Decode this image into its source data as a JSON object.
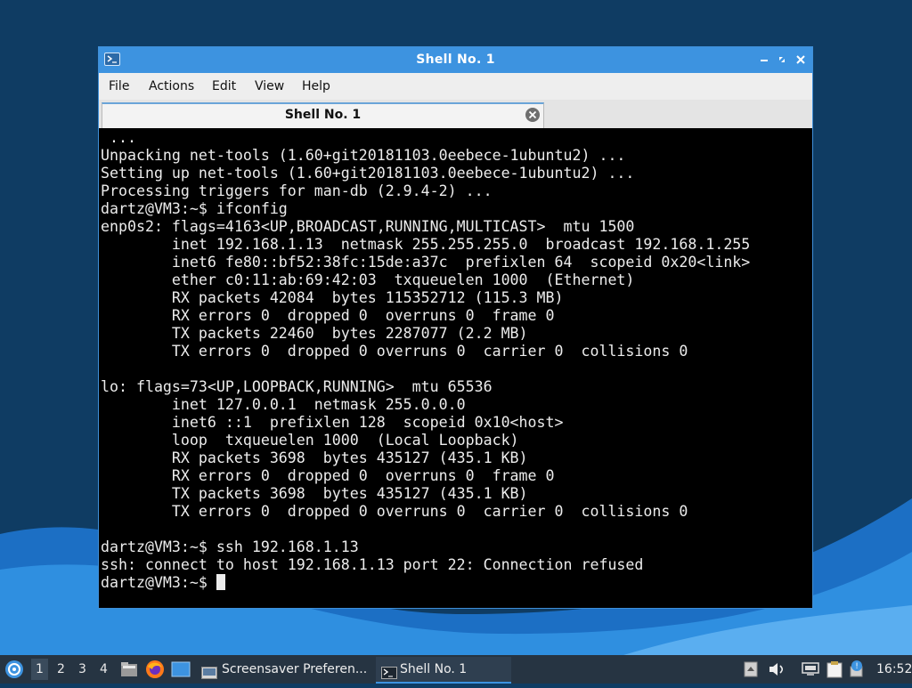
{
  "window": {
    "title": "Shell No. 1",
    "menu": [
      "File",
      "Actions",
      "Edit",
      "View",
      "Help"
    ],
    "tab_label": "Shell No. 1"
  },
  "terminal": {
    "lines": [
      " ...",
      "Unpacking net-tools (1.60+git20181103.0eebece-1ubuntu2) ...",
      "Setting up net-tools (1.60+git20181103.0eebece-1ubuntu2) ...",
      "Processing triggers for man-db (2.9.4-2) ...",
      "dartz@VM3:~$ ifconfig",
      "enp0s2: flags=4163<UP,BROADCAST,RUNNING,MULTICAST>  mtu 1500",
      "        inet 192.168.1.13  netmask 255.255.255.0  broadcast 192.168.1.255",
      "        inet6 fe80::bf52:38fc:15de:a37c  prefixlen 64  scopeid 0x20<link>",
      "        ether c0:11:ab:69:42:03  txqueuelen 1000  (Ethernet)",
      "        RX packets 42084  bytes 115352712 (115.3 MB)",
      "        RX errors 0  dropped 0  overruns 0  frame 0",
      "        TX packets 22460  bytes 2287077 (2.2 MB)",
      "        TX errors 0  dropped 0 overruns 0  carrier 0  collisions 0",
      "",
      "lo: flags=73<UP,LOOPBACK,RUNNING>  mtu 65536",
      "        inet 127.0.0.1  netmask 255.0.0.0",
      "        inet6 ::1  prefixlen 128  scopeid 0x10<host>",
      "        loop  txqueuelen 1000  (Local Loopback)",
      "        RX packets 3698  bytes 435127 (435.1 KB)",
      "        RX errors 0  dropped 0  overruns 0  frame 0",
      "        TX packets 3698  bytes 435127 (435.1 KB)",
      "        TX errors 0  dropped 0 overruns 0  carrier 0  collisions 0",
      "",
      "dartz@VM3:~$ ssh 192.168.1.13",
      "ssh: connect to host 192.168.1.13 port 22: Connection refused"
    ],
    "prompt": "dartz@VM3:~$ "
  },
  "taskbar": {
    "workspaces": [
      "1",
      "2",
      "3",
      "4"
    ],
    "active_workspace": "1",
    "tasks": [
      {
        "label": "Screensaver Preferen..."
      },
      {
        "label": "Shell No. 1"
      }
    ],
    "clock": "16:52"
  },
  "colors": {
    "titlebar": "#3d93e0",
    "desktop_dark": "#0f3c63",
    "desktop_wave": "#2f8fe0",
    "taskbar": "#263442"
  }
}
